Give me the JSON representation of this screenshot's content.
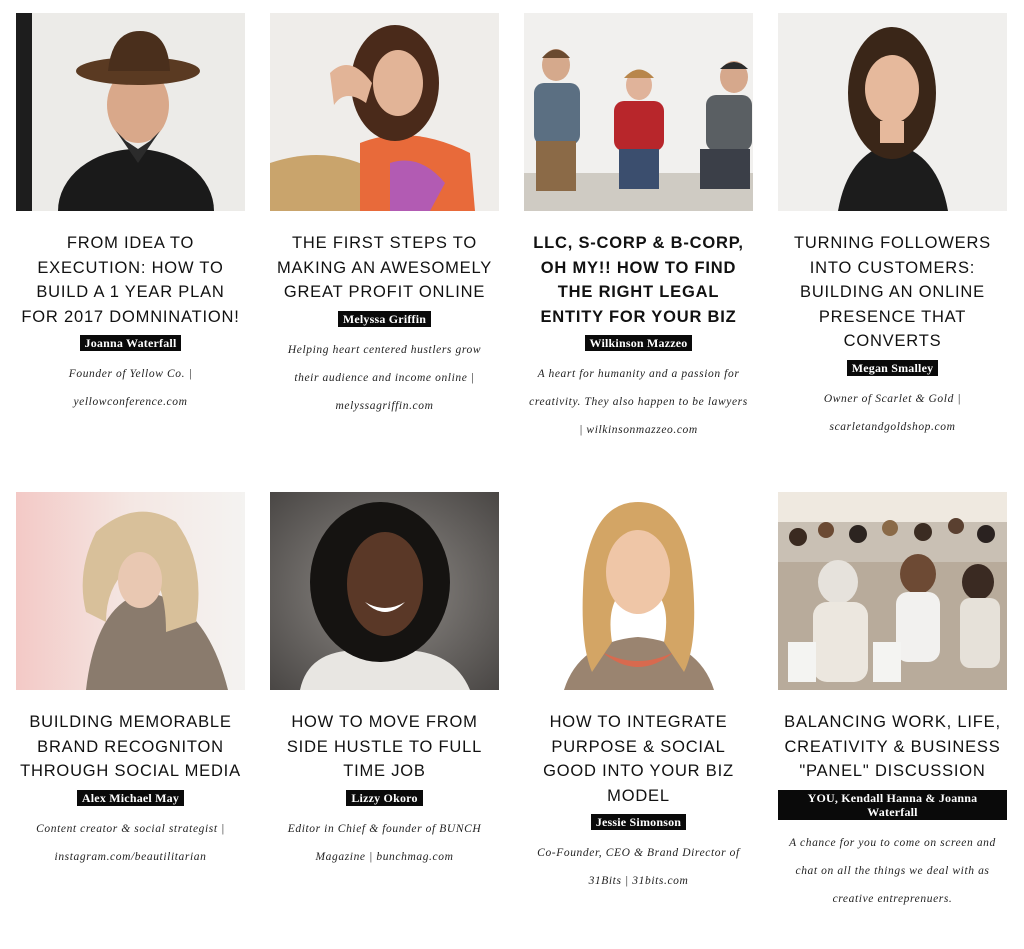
{
  "cards": [
    {
      "title": "FROM IDEA TO EXECUTION: HOW TO BUILD A 1 YEAR PLAN FOR 2017 DOMNINATION!",
      "speaker": "Joanna Waterfall",
      "description": "Founder of Yellow Co. | yellowconference.com",
      "photo_icon": "portrait-photo"
    },
    {
      "title": "THE FIRST STEPS TO MAKING AN AWESOMELY GREAT PROFIT ONLINE",
      "speaker": "Melyssa Griffin",
      "description": "Helping heart centered hustlers grow their audience and income online | melyssagriffin.com",
      "photo_icon": "portrait-photo"
    },
    {
      "title": "LLC, S-CORP & B-CORP, OH MY!! HOW TO FIND THE RIGHT LEGAL ENTITY FOR YOUR BIZ",
      "speaker": "Wilkinson Mazzeo",
      "description": "A heart for humanity and a passion for creativity. They also happen to be lawyers | wilkinsonmazzeo.com",
      "photo_icon": "group-photo"
    },
    {
      "title": "TURNING FOLLOWERS INTO CUSTOMERS: BUILDING AN ONLINE PRESENCE THAT CONVERTS",
      "speaker": "Megan Smalley",
      "description": "Owner of Scarlet & Gold | scarletandgoldshop.com",
      "photo_icon": "portrait-photo"
    },
    {
      "title": "BUILDING MEMORABLE BRAND RECOGNITON THROUGH SOCIAL MEDIA",
      "speaker": "Alex Michael May",
      "description": "Content creator & social strategist | instagram.com/beautilitarian",
      "photo_icon": "portrait-photo"
    },
    {
      "title": "HOW TO MOVE FROM SIDE HUSTLE TO FULL TIME JOB",
      "speaker": "Lizzy Okoro",
      "description": "Editor in Chief & founder of BUNCH Magazine | bunchmag.com",
      "photo_icon": "portrait-photo"
    },
    {
      "title": "HOW TO INTEGRATE PURPOSE & SOCIAL GOOD INTO YOUR BIZ MODEL",
      "speaker": "Jessie Simonson",
      "description": "Co-Founder, CEO & Brand Director of 31Bits | 31bits.com",
      "photo_icon": "portrait-photo"
    },
    {
      "title": "BALANCING WORK, LIFE, CREATIVITY & BUSINESS \"PANEL\" DISCUSSION",
      "speaker": "YOU, Kendall Hanna & Joanna Waterfall",
      "description": "A chance for you to come on screen and chat on all the things we deal with as creative entreprenuers.",
      "photo_icon": "crowd-photo"
    }
  ]
}
